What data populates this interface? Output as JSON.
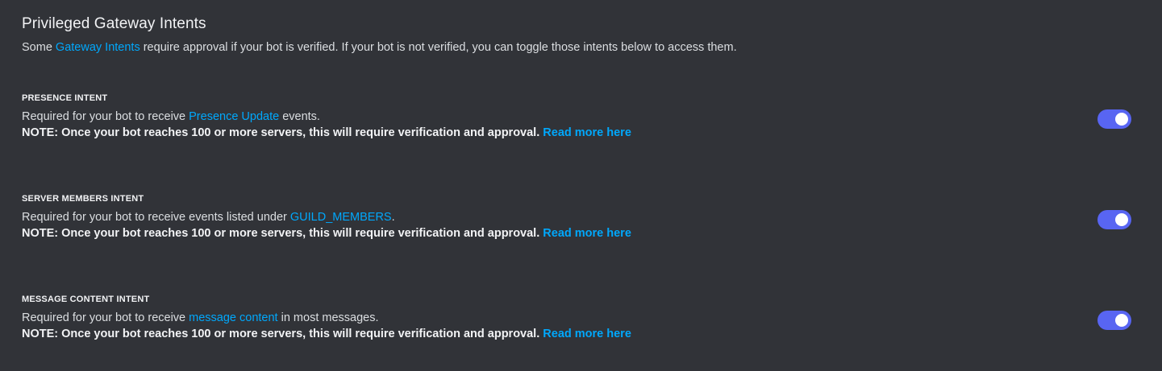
{
  "header": {
    "title": "Privileged Gateway Intents",
    "subtitle_prefix": "Some ",
    "subtitle_link": "Gateway Intents",
    "subtitle_suffix": " require approval if your bot is verified. If your bot is not verified, you can toggle those intents below to access them."
  },
  "intents": [
    {
      "heading": "PRESENCE INTENT",
      "desc_prefix": "Required for your bot to receive ",
      "desc_link": "Presence Update",
      "desc_suffix": " events.",
      "note": "NOTE: Once your bot reaches 100 or more servers, this will require verification and approval. ",
      "note_link": "Read more here",
      "enabled": true
    },
    {
      "heading": "SERVER MEMBERS INTENT",
      "desc_prefix": "Required for your bot to receive events listed under ",
      "desc_link": "GUILD_MEMBERS",
      "desc_suffix": ".",
      "note": "NOTE: Once your bot reaches 100 or more servers, this will require verification and approval. ",
      "note_link": "Read more here",
      "enabled": true
    },
    {
      "heading": "MESSAGE CONTENT INTENT",
      "desc_prefix": "Required for your bot to receive ",
      "desc_link": "message content",
      "desc_suffix": " in most messages.",
      "note": "NOTE: Once your bot reaches 100 or more servers, this will require verification and approval. ",
      "note_link": "Read more here",
      "enabled": true
    }
  ],
  "colors": {
    "background": "#313338",
    "link": "#00a8fc",
    "toggle_on": "#5865f2"
  }
}
